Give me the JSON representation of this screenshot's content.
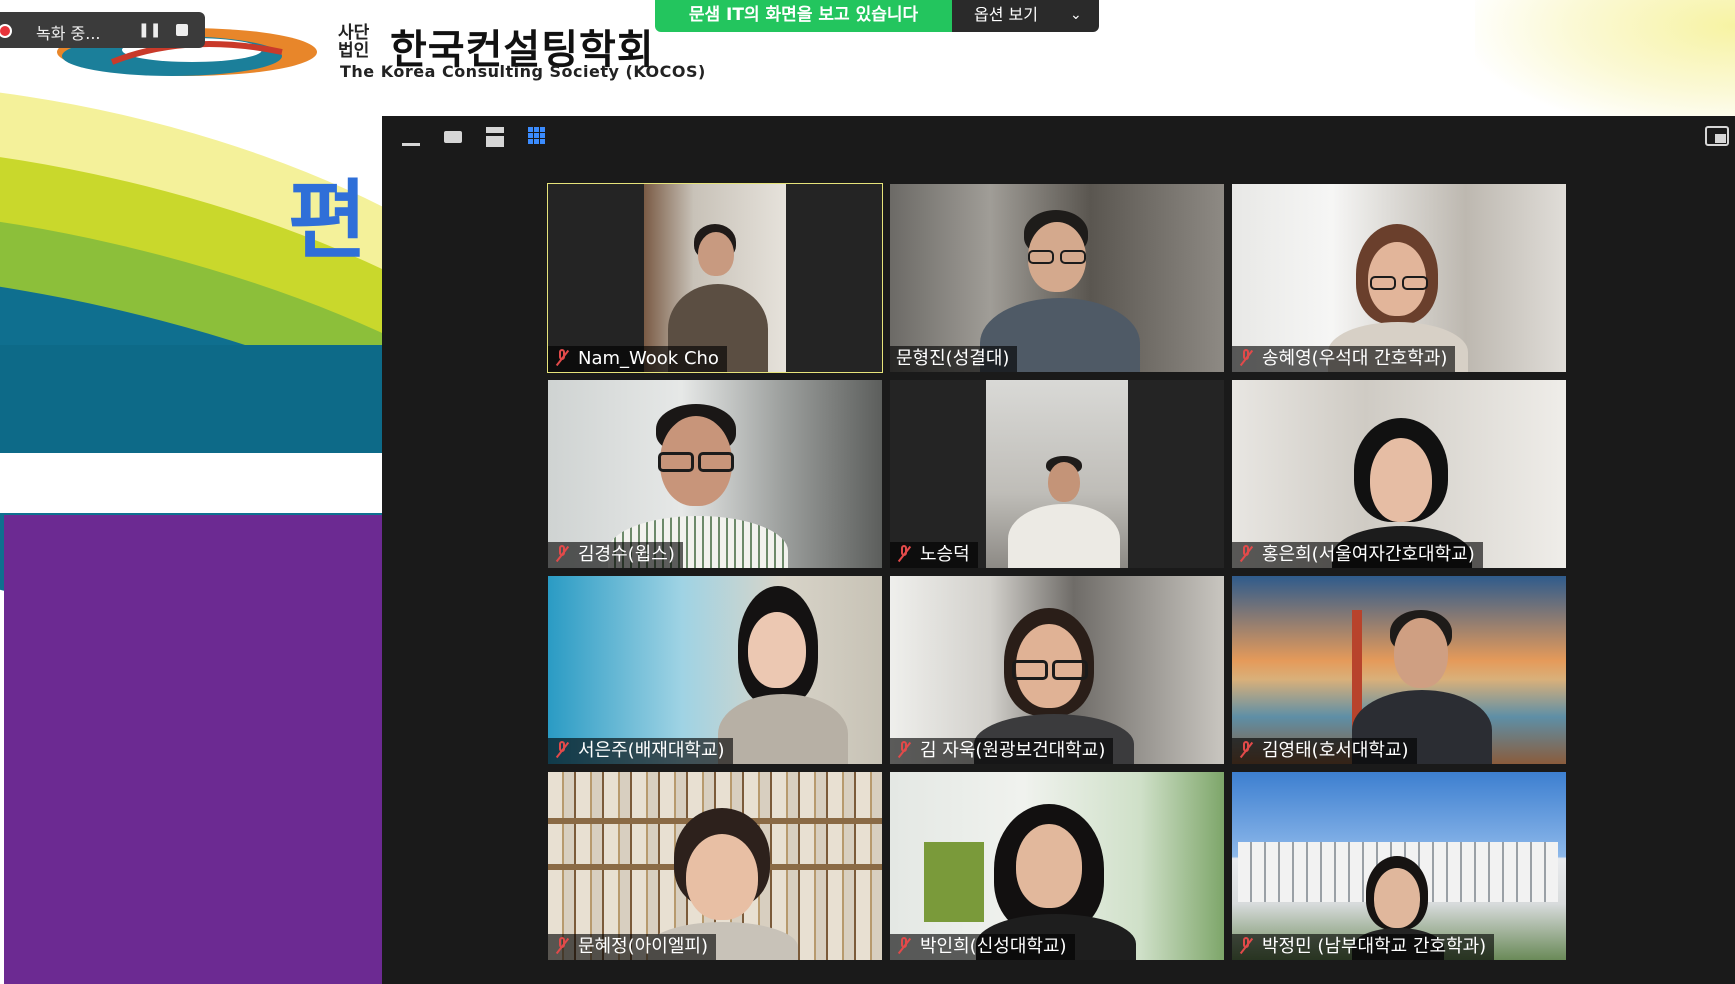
{
  "recording": {
    "label": "녹화 중...",
    "pause_icon": "pause-icon",
    "stop_icon": "stop-icon"
  },
  "share_bar": {
    "banner": "문샘 IT의 화면을 보고 있습니다",
    "options_label": "옵션 보기"
  },
  "slide": {
    "logo_prefix": "사단 법인",
    "logo_title": "한국컨설팅학회",
    "logo_subtitle": "The Korea Consulting Society (KOCOS)",
    "big_partial_text": "편",
    "colors": {
      "teal": "#0d6a88",
      "purple": "#6c2a92",
      "lime": "#c9d82c",
      "yellow": "#f4f19a",
      "blue_text": "#2f6fd8"
    }
  },
  "zoom": {
    "toolbar_icons": [
      "minimize-icon",
      "speaker-view-icon",
      "strip-view-icon",
      "gallery-view-icon"
    ],
    "exit_icon": "exit-fullscreen-icon",
    "colors": {
      "window_bg": "#1a1a1a",
      "active_outline": "#e6e37a",
      "muted_mic": "#e24a4a"
    },
    "participants": [
      {
        "name": "Nam_Wook Cho",
        "muted": true,
        "active": true
      },
      {
        "name": "문형진(성결대)",
        "muted": false
      },
      {
        "name": "송혜영(우석대 간호학과)",
        "muted": true
      },
      {
        "name": "김경수(윕스)",
        "muted": true
      },
      {
        "name": "노승덕",
        "muted": true
      },
      {
        "name": "홍은희(서울여자간호대학교)",
        "muted": true
      },
      {
        "name": "서은주(배재대학교)",
        "muted": true
      },
      {
        "name": "김 자욱(원광보건대학교)",
        "muted": true
      },
      {
        "name": "김영태(호서대학교)",
        "muted": true
      },
      {
        "name": "문혜정(아이엘피)",
        "muted": true
      },
      {
        "name": "박인희(신성대학교)",
        "muted": true
      },
      {
        "name": "박정민 (남부대학교 간호학과)",
        "muted": true
      }
    ]
  }
}
